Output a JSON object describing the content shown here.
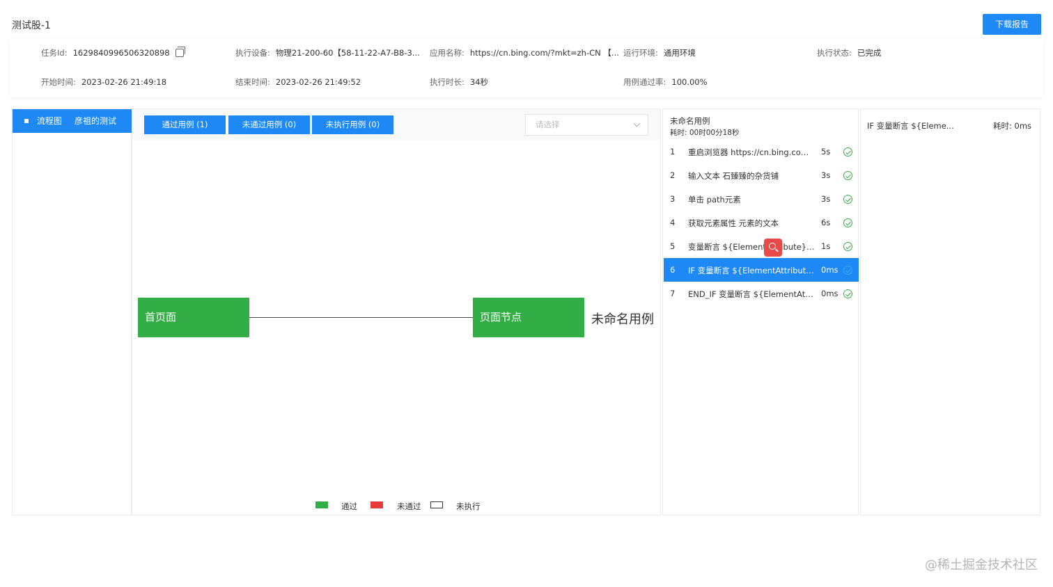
{
  "page": {
    "title": "测试股-1",
    "download_label": "下载报告"
  },
  "info": {
    "task_id_label": "任务Id:",
    "task_id": "1629840996506320898",
    "device_label": "执行设备:",
    "device": "物理21-200-60【58-11-22-A7-B8-3...",
    "app_label": "应用名称:",
    "app": "https://cn.bing.com/?mkt=zh-CN 【...",
    "env_label": "运行环境:",
    "env": "通用环境",
    "status_label": "执行状态:",
    "status": "已完成",
    "start_label": "开始时间:",
    "start": "2023-02-26 21:49:18",
    "end_label": "结束时间:",
    "end": "2023-02-26 21:49:52",
    "duration_label": "执行时长:",
    "duration": "34秒",
    "pass_rate_label": "用例通过率:",
    "pass_rate": "100.00%"
  },
  "left_tab": {
    "label": "流程图",
    "name": "彦祖的测试"
  },
  "filters": {
    "passed": "通过用例 (1)",
    "failed": "未通过用例 (0)",
    "not_run": "未执行用例 (0)",
    "select_placeholder": "请选择"
  },
  "flow": {
    "node1": "首页面",
    "node2": "页面节点",
    "case_label": "未命名用例"
  },
  "legend": {
    "passed": "通过",
    "failed": "未通过",
    "not_run": "未执行",
    "passed_color": "#33ad45",
    "failed_color": "#e83a3a"
  },
  "steps": {
    "title": "未命名用例",
    "time": "耗时: 00时00分18秒",
    "items": [
      {
        "num": "1",
        "name": "重启浏览器 https://cn.bing.com/...",
        "dur": "5s"
      },
      {
        "num": "2",
        "name": "输入文本 石臻臻的杂货铺",
        "dur": "3s"
      },
      {
        "num": "3",
        "name": "单击 path元素",
        "dur": "3s"
      },
      {
        "num": "4",
        "name": "获取元素属性 元素的文本",
        "dur": "6s"
      },
      {
        "num": "5",
        "name": "变量断言 ${ElementAttribute} 相...",
        "dur": "1s"
      },
      {
        "num": "6",
        "name": "IF 变量断言 ${ElementAttribute} ...",
        "dur": "0ms",
        "active": true
      },
      {
        "num": "7",
        "name": "END_IF 变量断言 ${ElementAttri...",
        "dur": "0ms"
      }
    ]
  },
  "detail": {
    "title": "IF 变量断言 ${Eleme...",
    "time": "耗时: 0ms"
  },
  "watermark": "@稀土掘金技术社区"
}
